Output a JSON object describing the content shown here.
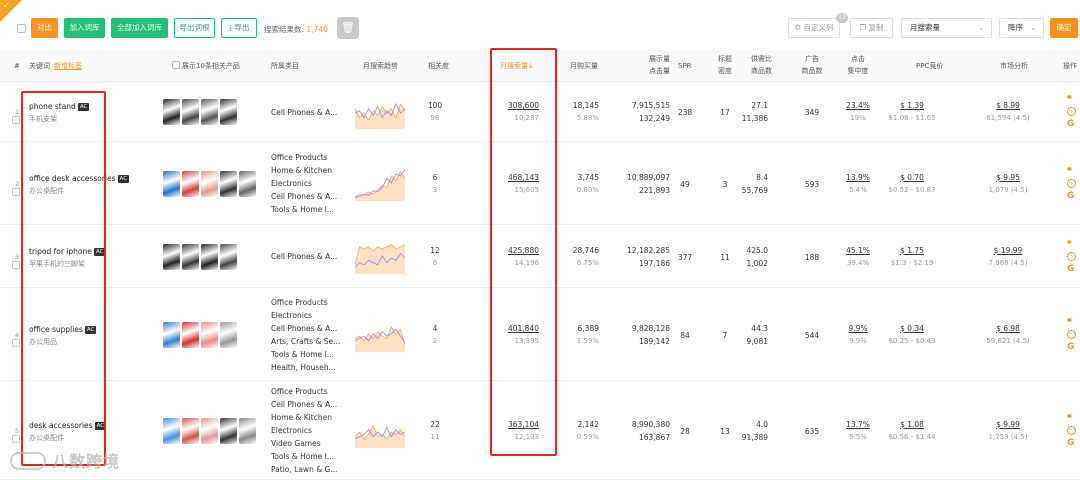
{
  "toolbar": {
    "flag": "✓",
    "btn_compare": "对比",
    "btn_add_lib": "加入词库",
    "btn_add_all": "全部加入词库",
    "btn_export_root": "导出词根",
    "btn_export": "导出",
    "result_label": "搜索结果数:",
    "result_count": "1,740",
    "custom_cols": "自定义列",
    "custom_cols_count": "13",
    "copy": "复制",
    "sort_field": "月搜索量",
    "sort_order": "降序",
    "confirm": "确定"
  },
  "columns": {
    "index": "#",
    "keyword": "关键词",
    "keyword_sub": "新增标签",
    "show_products": "展示10条相关产品",
    "category": "所属类目",
    "trend": "月搜索趋势",
    "relevance": "相关度",
    "monthly_search": "月搜索量↓",
    "monthly_purchase": "月购买量",
    "impressions": "展示量",
    "clicks": "点击量",
    "spr": "SPR",
    "title_density_1": "标题",
    "title_density_2": "密度",
    "supply_1": "供需比",
    "supply_2": "商品数",
    "ads_1": "广告",
    "ads_2": "商品数",
    "click_conc_1": "点击",
    "click_conc_2": "集中度",
    "ppc": "PPC竞价",
    "market": "市场分析",
    "ops": "操作"
  },
  "rows": [
    {
      "index": "1",
      "keyword": "phone stand",
      "ac": "AC",
      "keyword_cn": "手机支架",
      "categories": [
        "Cell Phones & A..."
      ],
      "relevance": "100",
      "relevance_sub": "98",
      "monthly_search": "308,600",
      "monthly_search_sub": "10,287",
      "purchase": "18,145",
      "purchase_pct": "5.88%",
      "impressions": "7,915,515",
      "clicks": "132,249",
      "spr": "238",
      "title_density": "17",
      "supply": "27.1",
      "supply_sub": "11,386",
      "ads": "349",
      "click_conc": "23.4%",
      "click_conc_sub": "19%",
      "ppc": "$ 1.39",
      "ppc_range": "$1.08 - $1.65",
      "market": "$ 8.99",
      "market_sub": "61,594 (4.5)",
      "trend_a": [
        18,
        10,
        14,
        8,
        16,
        12,
        20,
        14,
        18,
        10,
        22,
        16
      ],
      "trend_b": [
        14,
        16,
        10,
        18,
        12,
        20,
        10,
        16,
        12,
        22,
        14,
        18
      ]
    },
    {
      "index": "2",
      "keyword": "office desk accessories",
      "ac": "AC",
      "keyword_cn": "办公桌配件",
      "categories": [
        "Office Products",
        "Home & Kitchen",
        "Electronics",
        "Cell Phones & A...",
        "Tools & Home I..."
      ],
      "relevance": "6",
      "relevance_sub": "3",
      "monthly_search": "468,143",
      "monthly_search_sub": "15,605",
      "purchase": "3,745",
      "purchase_pct": "0.80%",
      "impressions": "10,889,097",
      "clicks": "221,893",
      "spr": "49",
      "title_density": "3",
      "supply": "8.4",
      "supply_sub": "55,769",
      "ads": "593",
      "click_conc": "13.9%",
      "click_conc_sub": "5.4%",
      "ppc": "$ 0.70",
      "ppc_range": "$0.52 - $0.87",
      "market": "$ 9.95",
      "market_sub": "1,079 (4.5)",
      "trend_a": [
        4,
        6,
        5,
        8,
        6,
        10,
        14,
        12,
        22,
        18,
        26,
        20
      ],
      "trend_b": [
        3,
        4,
        6,
        5,
        9,
        8,
        12,
        20,
        16,
        24,
        22,
        28
      ]
    },
    {
      "index": "3",
      "keyword": "tripod for iphone",
      "ac": "AC",
      "keyword_cn": "苹果手机的三脚架",
      "categories": [
        "Cell Phones & A..."
      ],
      "relevance": "12",
      "relevance_sub": "6",
      "monthly_search": "425,880",
      "monthly_search_sub": "14,196",
      "purchase": "28,746",
      "purchase_pct": "6.75%",
      "impressions": "12,182,285",
      "clicks": "197,186",
      "spr": "377",
      "title_density": "11",
      "supply": "425.0",
      "supply_sub": "1,002",
      "ads": "188",
      "click_conc": "45.1%",
      "click_conc_sub": "39.4%",
      "ppc": "$ 1.75",
      "ppc_range": "$1.3 - $2.19",
      "market": "$ 19.99",
      "market_sub": "7,968 (4.5)",
      "trend_a": [
        8,
        24,
        22,
        24,
        20,
        24,
        22,
        24,
        26,
        22,
        24,
        26
      ],
      "trend_b": [
        6,
        10,
        8,
        12,
        10,
        8,
        16,
        10,
        14,
        12,
        18,
        14
      ]
    },
    {
      "index": "4",
      "keyword": "office supplies",
      "ac": "AC",
      "keyword_cn": "办公用品",
      "categories": [
        "Office Products",
        "Electronics",
        "Cell Phones & A...",
        "Arts, Crafts & Se...",
        "Tools & Home I...",
        "Health, Househ..."
      ],
      "relevance": "4",
      "relevance_sub": "2",
      "monthly_search": "401,840",
      "monthly_search_sub": "13,395",
      "purchase": "6,389",
      "purchase_pct": "1.59%",
      "impressions": "9,828,128",
      "clicks": "189,142",
      "spr": "84",
      "title_density": "7",
      "supply": "44.3",
      "supply_sub": "9,081",
      "ads": "544",
      "click_conc": "9.9%",
      "click_conc_sub": "9.9%",
      "ppc": "$ 0.34",
      "ppc_range": "$0.25 - $0.43",
      "market": "$ 6.98",
      "market_sub": "59,621 (4.5)",
      "trend_a": [
        12,
        14,
        10,
        16,
        12,
        18,
        14,
        12,
        22,
        16,
        20,
        6
      ],
      "trend_b": [
        10,
        12,
        14,
        10,
        16,
        12,
        18,
        14,
        16,
        20,
        14,
        8
      ]
    },
    {
      "index": "5",
      "keyword": "desk accessories",
      "ac": "AC",
      "keyword_cn": "办公桌配件",
      "categories": [
        "Office Products",
        "Cell Phones & A...",
        "Home & Kitchen",
        "Electronics",
        "Video Games",
        "Tools & Home I...",
        "Patio, Lawn & G..."
      ],
      "relevance": "22",
      "relevance_sub": "11",
      "monthly_search": "363,104",
      "monthly_search_sub": "12,103",
      "purchase": "2,142",
      "purchase_pct": "0.59%",
      "impressions": "8,990,380",
      "clicks": "163,867",
      "spr": "28",
      "title_density": "13",
      "supply": "4.0",
      "supply_sub": "91,389",
      "ads": "635",
      "click_conc": "13.7%",
      "click_conc_sub": "5.5%",
      "ppc": "$ 1.08",
      "ppc_range": "$0.56 - $1.44",
      "market": "$ 9.99",
      "market_sub": "1,759 (4.5)",
      "trend_a": [
        10,
        14,
        8,
        12,
        20,
        10,
        12,
        8,
        14,
        12,
        16,
        10
      ],
      "trend_b": [
        8,
        10,
        12,
        16,
        10,
        14,
        10,
        18,
        10,
        16,
        12,
        14
      ]
    }
  ],
  "watermark": "八数跨境",
  "colors": {
    "accent": "#f5931f",
    "green": "#20c07a",
    "highlight": "#e8231e"
  }
}
